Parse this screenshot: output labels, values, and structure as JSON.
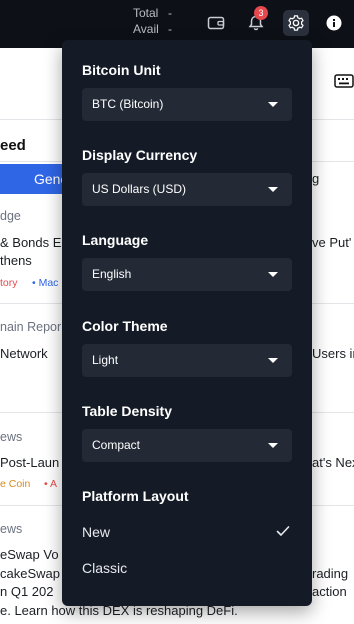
{
  "topbar": {
    "total_label": "Total",
    "total_value": "-",
    "avail_label": "Avail",
    "avail_value": "-",
    "notification_count": "3",
    "icons": [
      "wallet-icon",
      "bell-icon",
      "gear-icon",
      "info-icon"
    ]
  },
  "background": {
    "feed_title": "eed",
    "tab_general": "Gene",
    "right_fragment_1": "g",
    "items": [
      {
        "source": "dge",
        "title_left": "& Bonds E",
        "title_right": "ve Put'",
        "line2": "thens",
        "tags": [
          "tory",
          "• Mac"
        ]
      },
      {
        "source": "nain Repor",
        "title_left": "Network",
        "title_right": "Users in",
        "line2": "",
        "tags": []
      },
      {
        "source": "ews",
        "title_left": "Post-Laun",
        "title_right": "at's Nex",
        "line2": "",
        "tags": [
          "e Coin",
          "• A"
        ]
      },
      {
        "source": "ews",
        "title_left": "eSwap Vo",
        "title_right": "",
        "line2_left": "cakeSwap",
        "line2_right": "rading",
        "line3_left": "n Q1 202",
        "line3_right": "action",
        "line4": "e. Learn how this DEX is reshaping DeFi.",
        "tags": []
      }
    ]
  },
  "settings_menu": {
    "bitcoin_unit": {
      "label": "Bitcoin Unit",
      "value": "BTC (Bitcoin)"
    },
    "display_currency": {
      "label": "Display Currency",
      "value": "US Dollars (USD)"
    },
    "language": {
      "label": "Language",
      "value": "English"
    },
    "color_theme": {
      "label": "Color Theme",
      "value": "Light"
    },
    "table_density": {
      "label": "Table Density",
      "value": "Compact"
    },
    "platform_layout": {
      "label": "Platform Layout",
      "options": [
        {
          "label": "New",
          "selected": true
        },
        {
          "label": "Classic",
          "selected": false
        }
      ]
    }
  },
  "colors": {
    "topbar_bg": "#0d1117",
    "menu_bg": "#151b26",
    "select_bg": "#232a36",
    "accent_blue": "#2f66e6",
    "badge_red": "#e5484d"
  }
}
